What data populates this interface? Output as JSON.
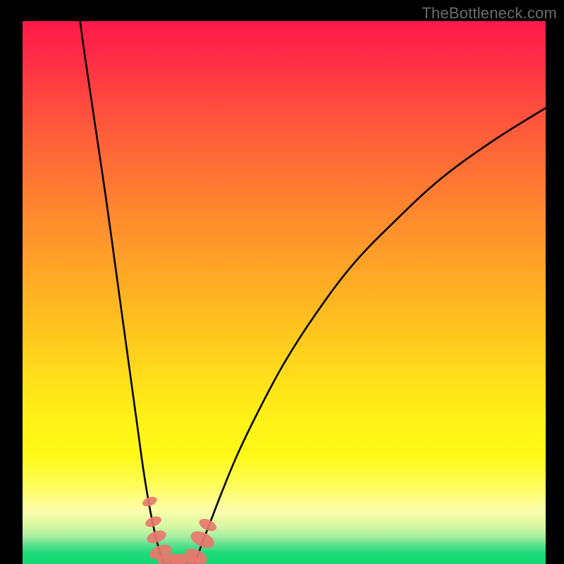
{
  "watermark": "TheBottleneck.com",
  "chart_data": {
    "type": "line",
    "title": "",
    "xlabel": "",
    "ylabel": "",
    "xlim": [
      0,
      100
    ],
    "ylim": [
      0,
      100
    ],
    "series": [
      {
        "name": "left-curve",
        "x": [
          11,
          12,
          14,
          16,
          18,
          20,
          21,
          22,
          23,
          24,
          25,
          26,
          27
        ],
        "values": [
          100,
          93,
          80,
          67,
          53,
          39,
          32,
          25,
          18,
          12,
          7,
          3,
          0
        ]
      },
      {
        "name": "right-curve",
        "x": [
          33,
          34,
          36,
          38,
          41,
          45,
          50,
          56,
          63,
          71,
          80,
          90,
          100
        ],
        "values": [
          0,
          3,
          8,
          13,
          20,
          28,
          37,
          46,
          55,
          63,
          71,
          78,
          84
        ]
      }
    ],
    "flat_bottom": {
      "x_from": 27,
      "x_to": 33,
      "y": 0
    },
    "markers": [
      {
        "x": 24.3,
        "y": 11.5,
        "r": 0.9
      },
      {
        "x": 25.0,
        "y": 7.8,
        "r": 1.0
      },
      {
        "x": 25.6,
        "y": 5.0,
        "r": 1.2
      },
      {
        "x": 26.4,
        "y": 2.2,
        "r": 1.4
      },
      {
        "x": 28.5,
        "y": 0.6,
        "r": 1.5
      },
      {
        "x": 31.0,
        "y": 0.6,
        "r": 1.5
      },
      {
        "x": 33.2,
        "y": 1.4,
        "r": 1.4
      },
      {
        "x": 34.4,
        "y": 4.5,
        "r": 1.5
      },
      {
        "x": 35.4,
        "y": 7.2,
        "r": 1.1
      }
    ],
    "gradient_stops": [
      {
        "pos": 0.0,
        "color": "#ff1a4a"
      },
      {
        "pos": 0.5,
        "color": "#ffb020"
      },
      {
        "pos": 0.8,
        "color": "#fff917"
      },
      {
        "pos": 0.96,
        "color": "#5be08e"
      },
      {
        "pos": 1.0,
        "color": "#0fd873"
      }
    ]
  }
}
